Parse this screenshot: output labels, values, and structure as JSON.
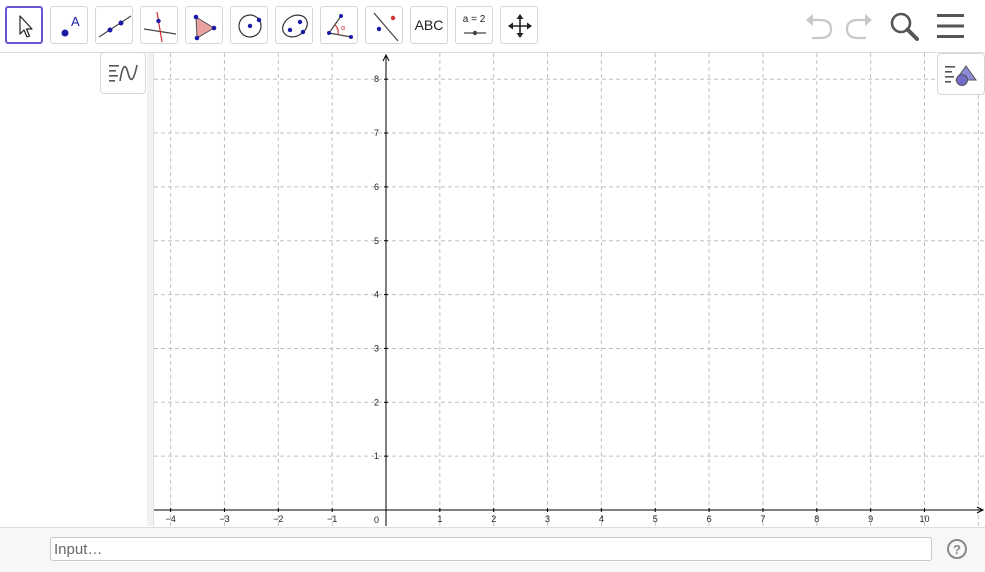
{
  "toolbar": {
    "tools": [
      {
        "name": "move-tool",
        "icon": "arrow-cursor-icon",
        "selected": true
      },
      {
        "name": "point-tool",
        "icon": "point-a-icon"
      },
      {
        "name": "line-tool",
        "icon": "line-through-points-icon"
      },
      {
        "name": "perpendicular-line-tool",
        "icon": "perpendicular-line-icon"
      },
      {
        "name": "polygon-tool",
        "icon": "polygon-icon"
      },
      {
        "name": "circle-tool",
        "icon": "circle-center-point-icon"
      },
      {
        "name": "ellipse-tool",
        "icon": "ellipse-icon"
      },
      {
        "name": "angle-tool",
        "icon": "angle-icon"
      },
      {
        "name": "reflect-tool",
        "icon": "reflect-about-line-icon"
      },
      {
        "name": "text-tool",
        "label": "ABC"
      },
      {
        "name": "slider-tool",
        "label": "a = 2"
      },
      {
        "name": "move-graphics-view-tool",
        "icon": "move-arrows-icon"
      }
    ],
    "undo_icon": "undo-icon",
    "redo_icon": "redo-icon",
    "search_icon": "search-icon",
    "menu_icon": "hamburger-menu-icon"
  },
  "algebra_view": {
    "style_bar_icon": "algebra-style-bar-icon"
  },
  "graphics_view": {
    "style_bar_icon": "graphics-style-bar-icon"
  },
  "axes": {
    "x_ticks": [
      "−4",
      "−3",
      "−2",
      "−1",
      "0",
      "1",
      "2",
      "3",
      "4",
      "5",
      "6",
      "7",
      "8",
      "9",
      "10"
    ],
    "y_ticks": [
      "1",
      "2",
      "3",
      "4",
      "5",
      "6",
      "7",
      "8"
    ],
    "grid": "dashed",
    "colors": {
      "grid": "#c0c0c0",
      "axis": "#000000"
    }
  },
  "input_bar": {
    "placeholder": "Input…",
    "value": "",
    "help_label": "?"
  },
  "colors": {
    "selected_tool_border": "#6557d2",
    "point_blue": "#1a1aa6",
    "accent_red": "#d23333",
    "polygon_fill": "#e8a0a0"
  }
}
